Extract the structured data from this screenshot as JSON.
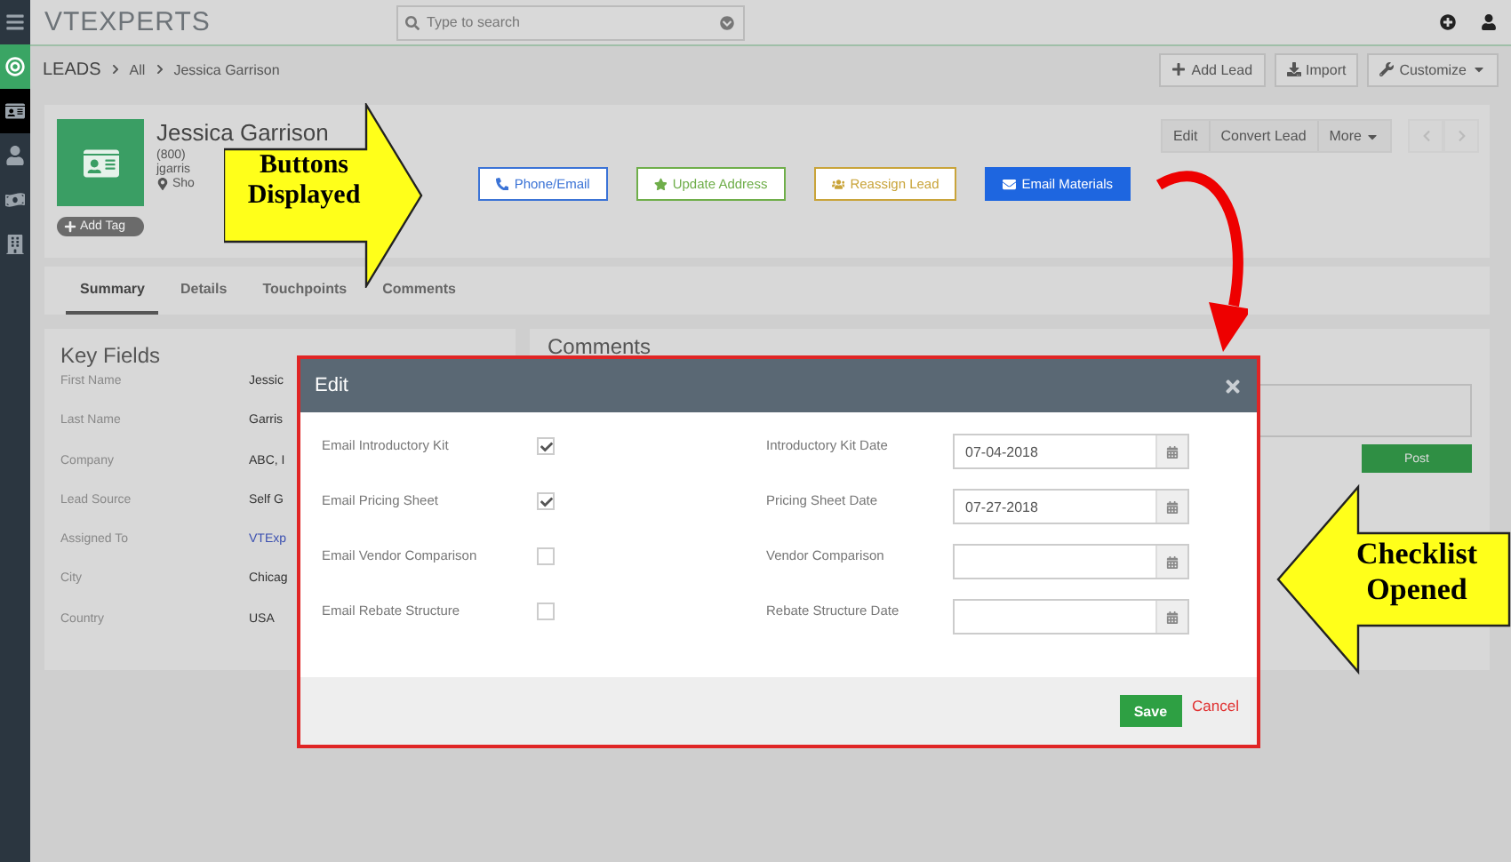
{
  "sidebar": {
    "items": [
      {
        "kind": "target",
        "selected": false
      },
      {
        "kind": "contact-card",
        "selected": true
      },
      {
        "kind": "person",
        "selected": false
      },
      {
        "kind": "money-bag",
        "selected": false
      },
      {
        "kind": "building",
        "selected": false
      }
    ]
  },
  "topbar": {
    "logo": "VTEXPERTS",
    "search": {
      "placeholder": "Type to search"
    }
  },
  "breadcrumb": [
    "LEADS",
    "All",
    "Jessica Garrison"
  ],
  "page_actions": [
    {
      "label": "Add Lead",
      "kind": "plus"
    },
    {
      "label": "Import",
      "kind": "download"
    },
    {
      "label": "Customize",
      "kind": "wrench"
    }
  ],
  "record": {
    "name": "Jessica Garrison",
    "phone": "(800)",
    "email": "jgarris",
    "location": "Sho",
    "tag_button": "Add Tag",
    "header_buttons": [
      "Edit",
      "Convert Lead",
      "More"
    ],
    "action_buttons": [
      {
        "label": "Phone/Email",
        "kind": "phone",
        "color": "#3b73d6"
      },
      {
        "label": "Update Address",
        "kind": "star",
        "color": "#6fae4a"
      },
      {
        "label": "Reassign Lead",
        "kind": "people",
        "color": "#c9a43a"
      },
      {
        "label": "Email Materials",
        "kind": "mail",
        "color": "#1e66e0"
      }
    ]
  },
  "tabs": [
    {
      "label": "Summary",
      "selected": true
    },
    {
      "label": "Details",
      "selected": false
    },
    {
      "label": "Touchpoints",
      "selected": false
    },
    {
      "label": "Comments",
      "selected": false
    }
  ],
  "key_fields": {
    "title": "Key Fields",
    "rows": [
      {
        "label": "First Name",
        "value": "Jessic",
        "link": false
      },
      {
        "label": "Last Name",
        "value": "Garris",
        "link": false
      },
      {
        "label": "Company",
        "value": "ABC, I",
        "link": false
      },
      {
        "label": "Lead Source",
        "value": "Self G",
        "link": false
      },
      {
        "label": "Assigned To",
        "value": "VTExp",
        "link": true
      },
      {
        "label": "City",
        "value": "Chicag",
        "link": false
      },
      {
        "label": "Country",
        "value": "USA",
        "link": false
      }
    ]
  },
  "comments": {
    "title": "Comments",
    "post_button": "Post"
  },
  "modal": {
    "title": "Edit",
    "checklist": [
      {
        "label": "Email Introductory Kit",
        "checked": true
      },
      {
        "label": "Email Pricing Sheet",
        "checked": true
      },
      {
        "label": "Email Vendor Comparison",
        "checked": false
      },
      {
        "label": "Email Rebate Structure",
        "checked": false
      }
    ],
    "dates": [
      {
        "label": "Introductory Kit Date",
        "value": "07-04-2018"
      },
      {
        "label": "Pricing Sheet Date",
        "value": "07-27-2018"
      },
      {
        "label": "Vendor Comparison"
      },
      {
        "label": "Rebate Structure Date"
      }
    ],
    "save": "Save",
    "cancel": "Cancel"
  },
  "annotations": [
    {
      "text": "Buttons Displayed"
    },
    {
      "text": "Checklist Opened"
    }
  ]
}
